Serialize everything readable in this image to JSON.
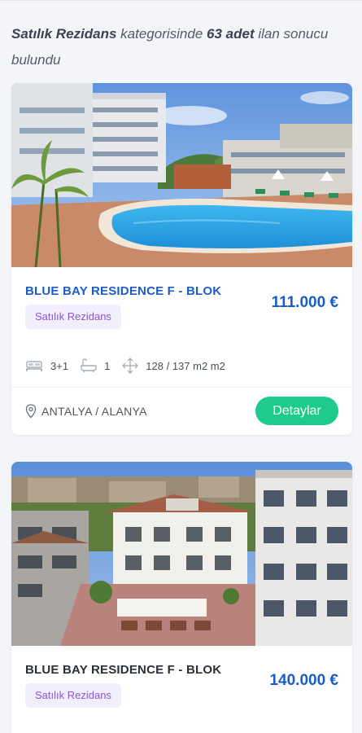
{
  "summary": {
    "category": "Satılık Rezidans",
    "text1": " kategorisinde ",
    "count": "63 adet",
    "text2": " ilan sonucu bulundu"
  },
  "listings": [
    {
      "title": "BLUE BAY RESIDENCE F - BLOK",
      "price": "111.000 €",
      "badge": "Satılık Rezidans",
      "rooms": "3+1",
      "baths": "1",
      "area": "128 / 137 m2 m2",
      "location": "ANTALYA / ALANYA",
      "button": "Detaylar"
    },
    {
      "title": "BLUE BAY RESIDENCE F - BLOK",
      "price": "140.000 €",
      "badge": "Satılık Rezidans"
    }
  ],
  "icons": {
    "rooms": "bed-icon",
    "baths": "bathtub-icon",
    "area": "area-arrows-icon",
    "location": "map-pin-icon"
  },
  "colors": {
    "title_blue": "#1d5cc4",
    "badge_bg": "#f2eefc",
    "badge_text": "#8a55d6",
    "button_green": "#1ecb8a"
  }
}
